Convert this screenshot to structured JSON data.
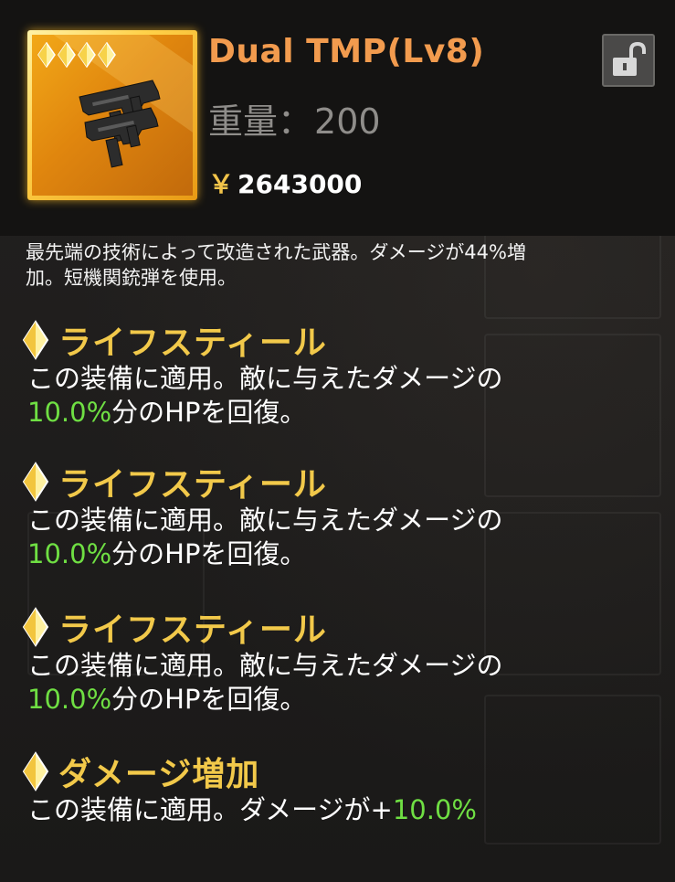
{
  "item": {
    "name": "Dual TMP(Lv8)",
    "weight_label": "重量：",
    "weight_value": "200",
    "currency": "￥",
    "price": "2643000",
    "star_count": 4,
    "description_line1": "最先端の技術によって改造された武器。ダメージが44%増",
    "description_line2": "加。短機関銃弾を使用。"
  },
  "effects": [
    {
      "title": "ライフスティール",
      "line1": "この装備に適用。敵に与えたダメージの",
      "value": "10.0%",
      "suffix": "分のHPを回復。"
    },
    {
      "title": "ライフスティール",
      "line1": "この装備に適用。敵に与えたダメージの",
      "value": "10.0%",
      "suffix": "分のHPを回復。"
    },
    {
      "title": "ライフスティール",
      "line1": "この装備に適用。敵に与えたダメージの",
      "value": "10.0%",
      "suffix": "分のHPを回復。"
    },
    {
      "title": "ダメージ増加",
      "line1": "この装備に適用。ダメージが+",
      "value": "10.0%",
      "suffix": ""
    }
  ],
  "colors": {
    "title": "#f29b4e",
    "effect_title": "#f2c94a",
    "highlight": "#6fdf43",
    "rarity_frame": "#ffd24a"
  },
  "icons": {
    "lock": "unlocked-padlock-icon",
    "effect_bullet": "gold-diamond-icon",
    "rarity": "gold-diamond-icon"
  }
}
